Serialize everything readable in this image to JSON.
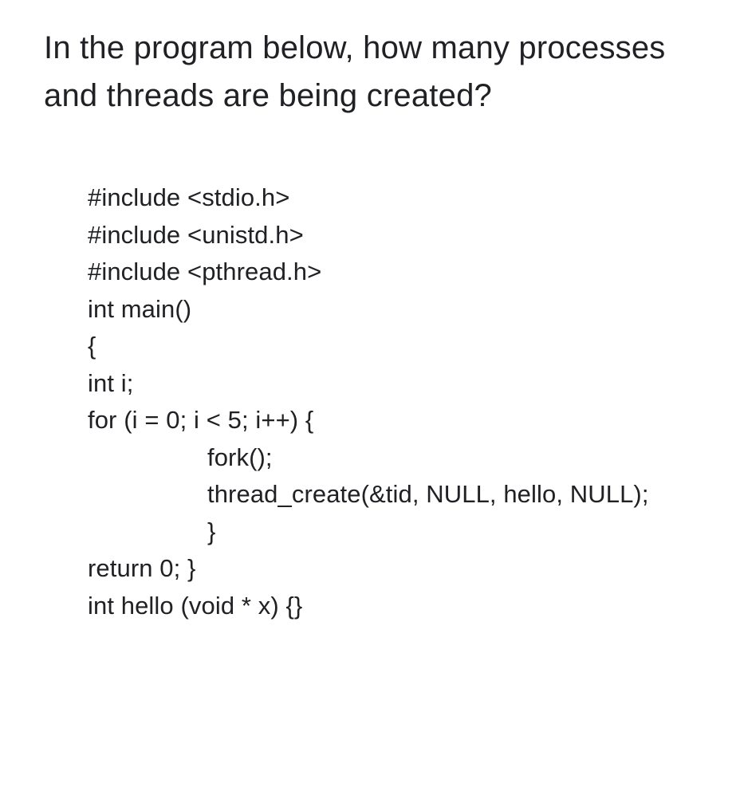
{
  "question": "In the program below, how many processes and threads are being created?",
  "code": {
    "lines": [
      "#include <stdio.h>",
      "#include <unistd.h>",
      "#include <pthread.h>",
      "int main()",
      "{",
      "int i;",
      "for (i = 0; i < 5; i++) {"
    ],
    "indented": [
      "fork();",
      "thread_create(&tid, NULL, hello, NULL);",
      "}"
    ],
    "after": [
      "return 0; }",
      "",
      "int hello (void * x) {}"
    ]
  }
}
